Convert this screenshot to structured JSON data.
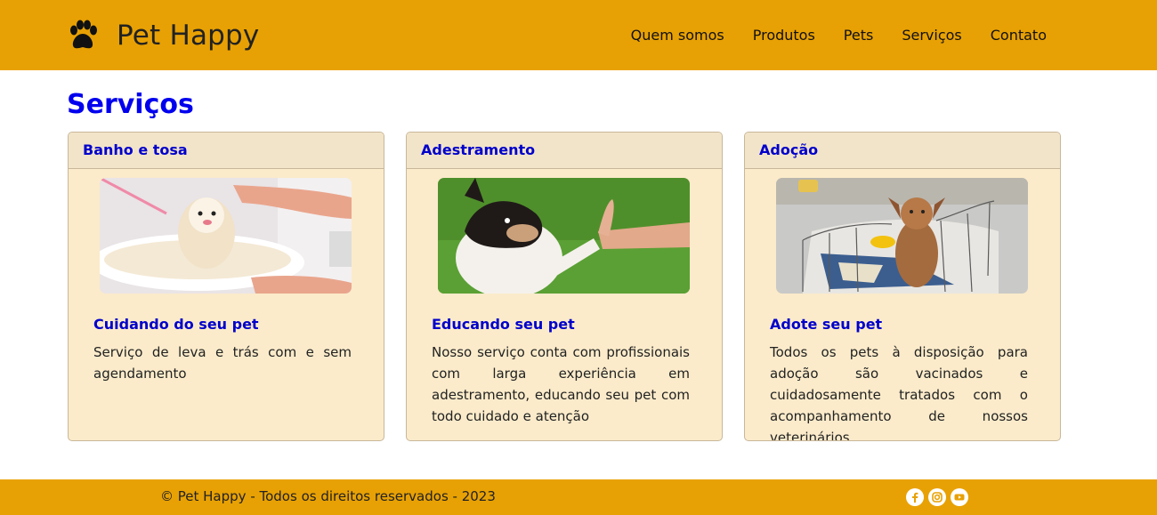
{
  "header": {
    "brand_name": "Pet Happy",
    "brand_icon": "paw-icon",
    "nav": [
      "Quem somos",
      "Produtos",
      "Pets",
      "Serviços",
      "Contato"
    ]
  },
  "main": {
    "title": "Serviços",
    "cards": [
      {
        "header": "Banho e tosa",
        "subtitle": "Cuidando do seu pet",
        "text": "Serviço de leva e trás com e sem agendamento",
        "image": "dog-bath-photo"
      },
      {
        "header": "Adestramento",
        "subtitle": "Educando seu pet",
        "text": "Nosso serviço conta com profissionais com larga experiência em adestramento, educando seu pet com todo cuidado e atenção",
        "image": "dog-training-photo"
      },
      {
        "header": "Adoção",
        "subtitle": "Adote seu pet",
        "text": "Todos os pets à disposição para adoção são vacinados e cuidadosamente tratados com o acompanhamento de nossos veterinários",
        "image": "puppy-adoption-photo"
      }
    ]
  },
  "footer": {
    "copyright": "© Pet Happy - Todos os direitos reservados - 2023",
    "socials": [
      "facebook-icon",
      "instagram-icon",
      "youtube-icon"
    ]
  },
  "colors": {
    "header_bg": "#e8a104",
    "title": "#0000ee",
    "card_bg": "#fbebca",
    "card_head_bg": "#f2e4c8"
  }
}
